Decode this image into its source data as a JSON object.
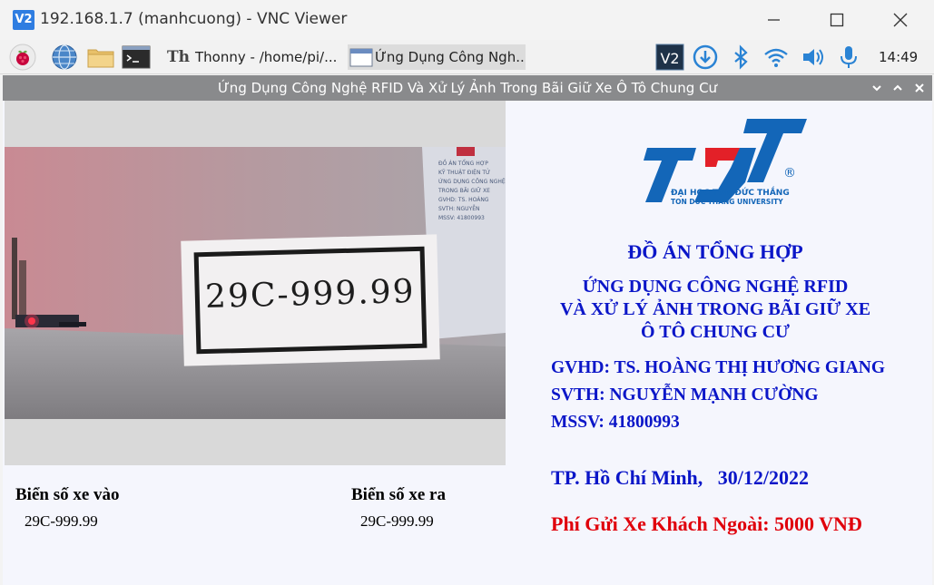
{
  "vnc": {
    "logo_text": "V2",
    "title": "192.168.1.7 (manhcuong) - VNC Viewer"
  },
  "taskbar": {
    "icons": [
      "raspberry-icon",
      "web-browser-icon",
      "file-manager-icon",
      "terminal-icon"
    ],
    "thonny_label": "Thonny  -  /home/pi/...",
    "app_task_label": "Ứng Dụng Công Ngh...",
    "tray_icons": [
      "vnc-icon",
      "download-icon",
      "bluetooth-icon",
      "wifi-icon",
      "volume-icon",
      "microphone-icon"
    ],
    "clock": "14:49"
  },
  "app": {
    "window_title": "Ứng Dụng Công Nghệ RFID Và Xử Lý Ảnh Trong Bãi Giữ Xe Ô Tô Chung Cư",
    "camera": {
      "plate_text": "29C-999.99",
      "doc_text": "ĐỒ ÁN TỔNG HỢP\nKỸ THUẬT ĐIỆN TỬ\nỨNG DỤNG CÔNG NGHỆ\nTRONG BÃI GIỮ XE\nGVHD: TS. HOÀNG\nSVTH: NGUYỄN\nMSSV: 41800993"
    },
    "entry_label": "Biển số xe vào",
    "entry_value": "29C-999.99",
    "exit_label": "Biển số xe ra",
    "exit_value": "29C-999.99",
    "logo": {
      "letters": "TDT",
      "registered": "®",
      "line1": "ĐẠI HỌC TÔN ĐỨC THẮNG",
      "line2": "TON DUC THANG UNIVERSITY"
    },
    "heading": "ĐỒ ÁN TỔNG HỢP",
    "project_lines": [
      "ỨNG DỤNG CÔNG NGHỆ RFID",
      "VÀ XỬ LÝ ẢNH TRONG BÃI GIỮ XE",
      "Ô TÔ CHUNG CƯ"
    ],
    "supervisor": "GVHD: TS. HOÀNG THỊ HƯƠNG GIANG",
    "student": "SVTH: NGUYỄN MẠNH CƯỜNG",
    "student_id": "MSSV: 41800993",
    "city_date": "TP. Hồ Chí Minh,   30/12/2022",
    "fee": "Phí Gửi Xe Khách Ngoài: 5000 VNĐ"
  },
  "colors": {
    "brand_blue": "#0b16c8",
    "fee_red": "#e0000b",
    "logo_blue": "#1366b8",
    "logo_red": "#e32028"
  }
}
